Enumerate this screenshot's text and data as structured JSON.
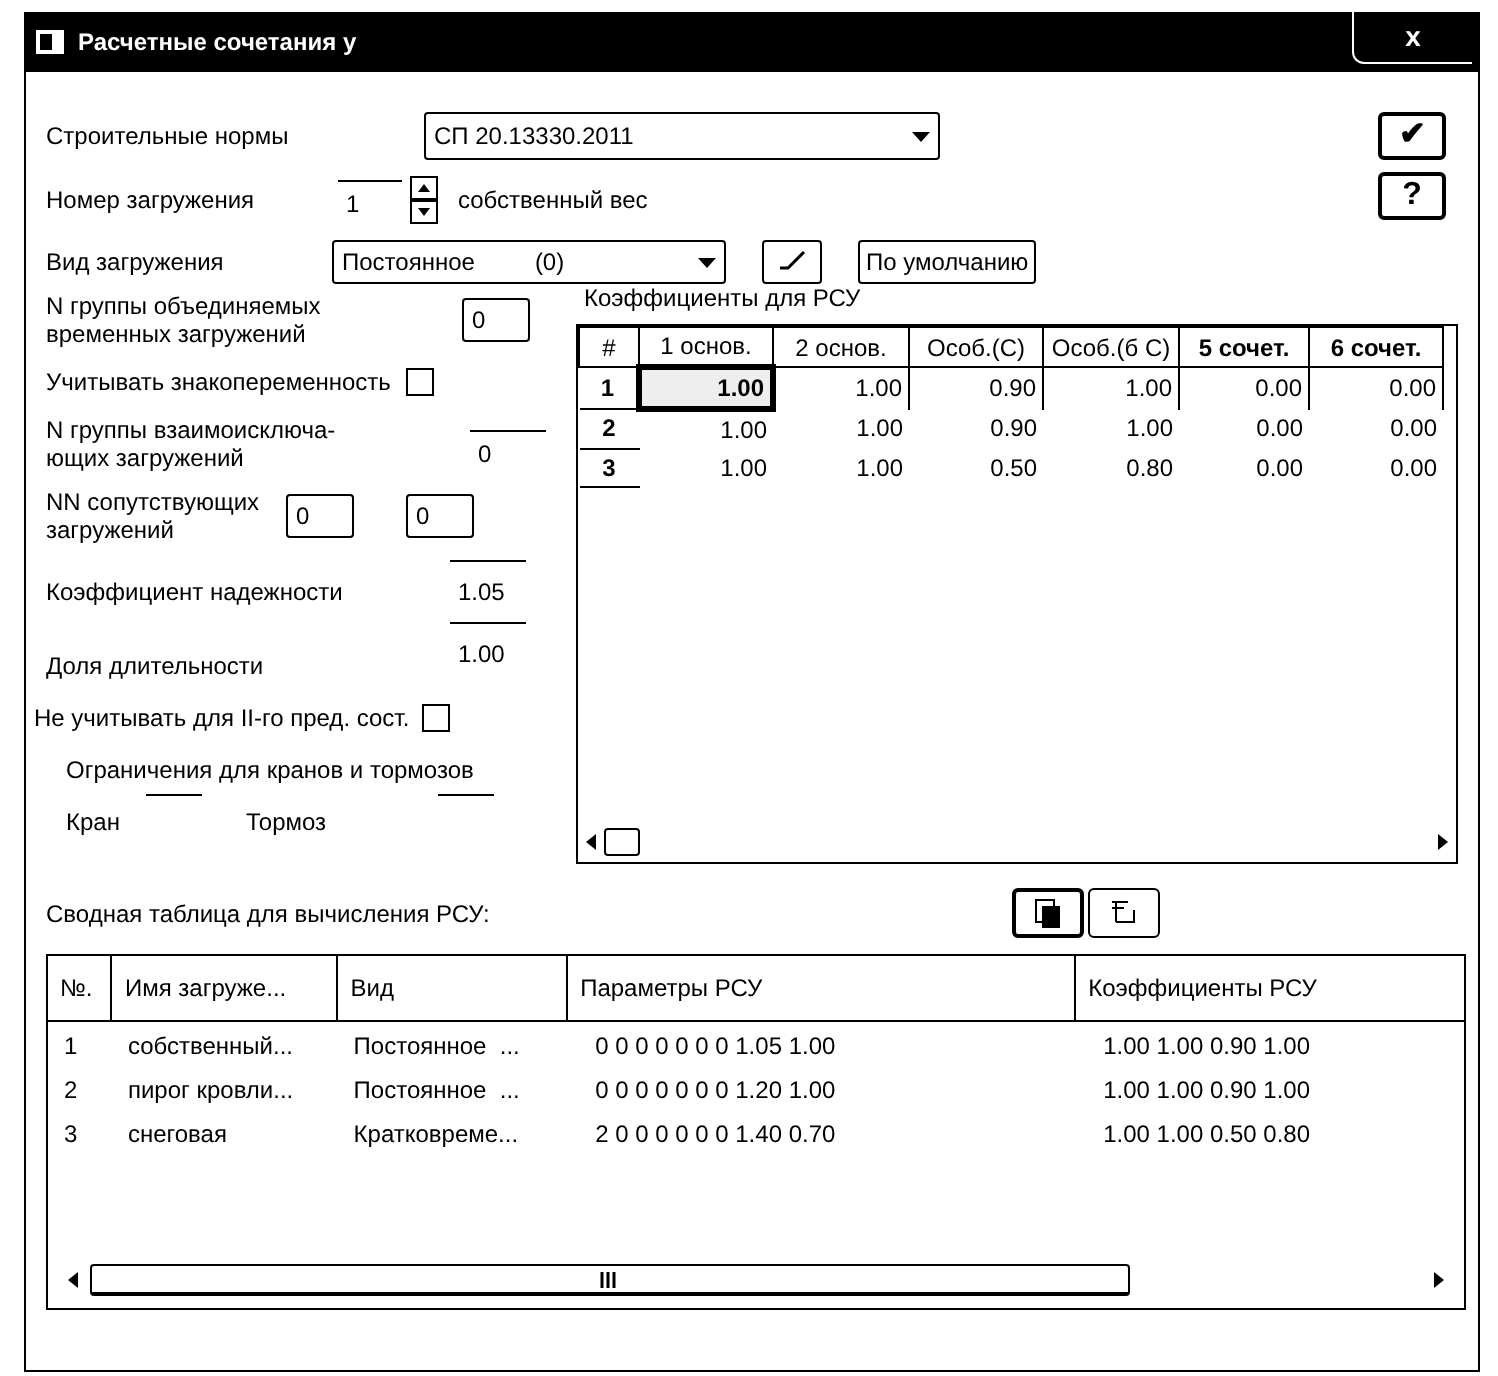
{
  "window": {
    "title": "Расчетные сочетания у",
    "close": "x"
  },
  "norms": {
    "label": "Строительные нормы",
    "value": "СП 20.13330.2011"
  },
  "load_number": {
    "label": "Номер загружения",
    "value": "1",
    "name": "собственный вес"
  },
  "load_type": {
    "label": "Вид загружения",
    "value": "Постоянное",
    "code": "(0)",
    "default_button": "По умолчанию"
  },
  "side_buttons": {
    "ok": "✔",
    "help": "?"
  },
  "left_panel": {
    "group_union": {
      "label": [
        "N группы объединяемых",
        "временных загружений"
      ],
      "value": "0"
    },
    "alternating": {
      "label": "Учитывать знакопеременность",
      "checked": false
    },
    "exclusive_group": {
      "label": [
        "N группы взаимоисключа-",
        "ющих загружений"
      ],
      "value": "0"
    },
    "accompanying": {
      "label": [
        "NN сопутствующих",
        "загружений"
      ],
      "values": [
        "0",
        "0"
      ]
    },
    "reliability": {
      "label": "Коэффициент надежности",
      "value": "1.05"
    },
    "duration": {
      "label": "Доля длительности",
      "value": "1.00"
    },
    "no_second_state": {
      "label": "Не учитывать для II-го пред. сост.",
      "checked": false
    },
    "limits": {
      "label": "Ограничения для кранов и тормозов",
      "crane": "Кран",
      "brake": "Тормоз"
    }
  },
  "coef_grid": {
    "title": "Коэффициенты для РСУ",
    "columns": [
      {
        "label": "#",
        "bold": false
      },
      {
        "label": "1 основ.",
        "bold": false
      },
      {
        "label": "2 основ.",
        "bold": false
      },
      {
        "label": "Особ.(С)",
        "bold": false
      },
      {
        "label": "Особ.(б С)",
        "bold": false
      },
      {
        "label": "5 сочет.",
        "bold": true
      },
      {
        "label": "6 сочет.",
        "bold": true
      }
    ],
    "rows": [
      {
        "cells": [
          {
            "text": "1",
            "selected": false
          },
          {
            "text": "1.00",
            "selected": true
          },
          {
            "text": "1.00",
            "selected": false
          },
          {
            "text": "0.90",
            "selected": false
          },
          {
            "text": "1.00",
            "selected": false
          },
          {
            "text": "0.00",
            "selected": false
          },
          {
            "text": "0.00",
            "selected": false
          }
        ]
      },
      {
        "cells": [
          {
            "text": "2",
            "selected": false
          },
          {
            "text": "1.00",
            "selected": false
          },
          {
            "text": "1.00",
            "selected": false
          },
          {
            "text": "0.90",
            "selected": false
          },
          {
            "text": "1.00",
            "selected": false
          },
          {
            "text": "0.00",
            "selected": false
          },
          {
            "text": "0.00",
            "selected": false
          }
        ]
      },
      {
        "cells": [
          {
            "text": "3",
            "selected": false
          },
          {
            "text": "1.00",
            "selected": false
          },
          {
            "text": "1.00",
            "selected": false
          },
          {
            "text": "0.50",
            "selected": false
          },
          {
            "text": "0.80",
            "selected": false
          },
          {
            "text": "0.00",
            "selected": false
          },
          {
            "text": "0.00",
            "selected": false
          }
        ]
      }
    ]
  },
  "summary": {
    "title": "Сводная таблица для вычисления РСУ:",
    "columns": [
      "№.",
      "Имя загруже...",
      "Вид",
      "Параметры РСУ",
      "Коэффициенты РСУ"
    ],
    "rows": [
      [
        "1",
        "собственный...",
        "Постоянное  ...",
        "0 0 0 0 0 0 0 1.05 1.00",
        "1.00 1.00 0.90 1.00"
      ],
      [
        "2",
        "пирог кровли...",
        "Постоянное  ...",
        "0 0 0 0 0 0 0 1.20 1.00",
        "1.00 1.00 0.90 1.00"
      ],
      [
        "3",
        "снеговая",
        "Кратковреме...",
        "2 0 0 0 0 0 0 1.40 0.70",
        "1.00 1.00 0.50 0.80"
      ]
    ]
  }
}
